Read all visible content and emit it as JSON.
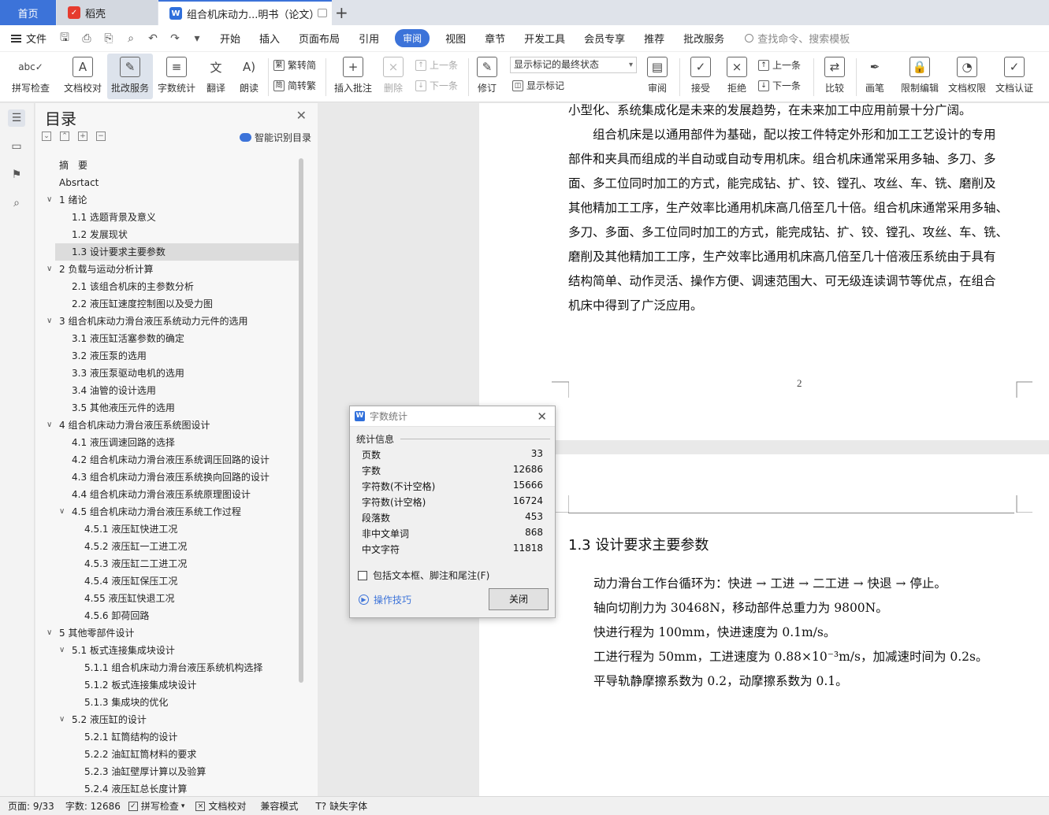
{
  "tabs": {
    "home": "首页",
    "daoke": "稻壳",
    "doc": "组合机床动力...明书（论文）"
  },
  "menubar": {
    "file": "文件",
    "items": [
      "开始",
      "插入",
      "页面布局",
      "引用",
      "审阅",
      "视图",
      "章节",
      "开发工具",
      "会员专享",
      "推荐",
      "批改服务"
    ],
    "active": "审阅",
    "search": "查找命令、搜索模板"
  },
  "ribbon": {
    "spell": "拼写检查",
    "doccheck": "文档校对",
    "revise_service": "批改服务",
    "wordcount": "字数统计",
    "translate": "翻译",
    "read": "朗读",
    "trad": "繁转简",
    "simp": "简转繁",
    "insert_comment": "插入批注",
    "delete": "删除",
    "prev": "上一条",
    "next": "下一条",
    "track": "修订",
    "markup_state": "显示标记的最终状态",
    "show_markup": "显示标记",
    "review": "审阅",
    "accept": "接受",
    "reject": "拒绝",
    "prev2": "上一条",
    "next2": "下一条",
    "compare": "比较",
    "pen": "画笔",
    "restrict": "限制编辑",
    "permission": "文档权限",
    "certify": "文档认证"
  },
  "toc": {
    "title": "目录",
    "smart": "智能识别目录",
    "items": [
      {
        "text": "摘　要",
        "level": 0
      },
      {
        "text": "Absrtact",
        "level": 0
      },
      {
        "text": "1  绪论",
        "level": 1
      },
      {
        "text": "1.1  选题背景及意义",
        "level": 2
      },
      {
        "text": "1.2  发展现状",
        "level": 2
      },
      {
        "text": "1.3  设计要求主要参数",
        "level": 2,
        "selected": true
      },
      {
        "text": "2  负载与运动分析计算",
        "level": 1
      },
      {
        "text": "2.1  该组合机床的主参数分析",
        "level": 2
      },
      {
        "text": "2.2  液压缸速度控制图以及受力图",
        "level": 2
      },
      {
        "text": "3  组合机床动力滑台液压系统动力元件的选用",
        "level": 1
      },
      {
        "text": "3.1  液压缸活塞参数的确定",
        "level": 2
      },
      {
        "text": "3.2  液压泵的选用",
        "level": 2
      },
      {
        "text": "3.3  液压泵驱动电机的选用",
        "level": 2
      },
      {
        "text": "3.4  油管的设计选用",
        "level": 2
      },
      {
        "text": "3.5  其他液压元件的选用",
        "level": 2
      },
      {
        "text": "4  组合机床动力滑台液压系统图设计",
        "level": 1
      },
      {
        "text": "4.1  液压调速回路的选择",
        "level": 2
      },
      {
        "text": "4.2  组合机床动力滑台液压系统调压回路的设计",
        "level": 2
      },
      {
        "text": "4.3  组合机床动力滑台液压系统换向回路的设计",
        "level": 2
      },
      {
        "text": "4.4  组合机床动力滑台液压系统原理图设计",
        "level": 2
      },
      {
        "text": "4.5  组合机床动力滑台液压系统工作过程",
        "level": 2,
        "expand": true
      },
      {
        "text": "4.5.1  液压缸快进工况",
        "level": 3
      },
      {
        "text": "4.5.2  液压缸一工进工况",
        "level": 3
      },
      {
        "text": "4.5.3 液压缸二工进工况",
        "level": 3
      },
      {
        "text": "4.5.4  液压缸保压工况",
        "level": 3
      },
      {
        "text": "4.55  液压缸快退工况",
        "level": 3
      },
      {
        "text": "4.5.6  卸荷回路",
        "level": 3
      },
      {
        "text": "5  其他零部件设计",
        "level": 1
      },
      {
        "text": "5.1  板式连接集成块设计",
        "level": 2,
        "expand": true
      },
      {
        "text": "5.1.1  组合机床动力滑台液压系统机构选择",
        "level": 3
      },
      {
        "text": "5.1.2  板式连接集成块设计",
        "level": 3
      },
      {
        "text": "5.1.3  集成块的优化",
        "level": 3
      },
      {
        "text": "5.2  液压缸的设计",
        "level": 2,
        "expand": true
      },
      {
        "text": "5.2.1  缸筒结构的设计",
        "level": 3
      },
      {
        "text": "5.2.2  油缸缸筒材料的要求",
        "level": 3
      },
      {
        "text": "5.2.3  油缸壁厚计算以及验算",
        "level": 3
      },
      {
        "text": "5.2.4  液压缸总长度计算",
        "level": 3
      }
    ]
  },
  "document": {
    "page1_lines": [
      "小型化、系统集成化是未来的发展趋势，在未来加工中应用前景十分广阔。",
      "　　组合机床是以通用部件为基础，配以按工件特定外形和加工工艺设计的专用",
      "部件和夹具而组成的半自动或自动专用机床。组合机床通常采用多轴、多刀、多",
      "面、多工位同时加工的方式，能完成钻、扩、铰、镗孔、攻丝、车、铣、磨削及",
      "其他精加工工序，生产效率比通用机床高几倍至几十倍。组合机床通常采用多轴、",
      "多刀、多面、多工位同时加工的方式，能完成钻、扩、铰、镗孔、攻丝、车、铣、",
      "磨削及其他精加工工序，生产效率比通用机床高几倍至几十倍液压系统由于具有",
      "结构简单、动作灵活、操作方便、调速范围大、可无级连读调节等优点，在组合",
      "机床中得到了广泛应用。"
    ],
    "page_number": "2",
    "heading": "1.3  设计要求主要参数",
    "page2_lines": [
      "动力滑台工作台循环为：快进 → 工进 → 二工进 → 快退 → 停止。",
      "轴向切削力为 30468N，移动部件总重力为 9800N。",
      "快进行程为 100mm，快进速度为 0.1m/s。",
      "工进行程为 50mm，工进速度为 0.88×10⁻³m/s，加减速时间为 0.2s。",
      "平导轨静摩擦系数为 0.2，动摩擦系数为 0.1。"
    ]
  },
  "dialog": {
    "title": "字数统计",
    "section": "统计信息",
    "stats": [
      {
        "label": "页数",
        "value": "33"
      },
      {
        "label": "字数",
        "value": "12686"
      },
      {
        "label": "字符数(不计空格)",
        "value": "15666"
      },
      {
        "label": "字符数(计空格)",
        "value": "16724"
      },
      {
        "label": "段落数",
        "value": "453"
      },
      {
        "label": "非中文单词",
        "value": "868"
      },
      {
        "label": "中文字符",
        "value": "11818"
      }
    ],
    "checkbox": "包括文本框、脚注和尾注(F)",
    "tips": "操作技巧",
    "close": "关闭"
  },
  "status": {
    "page": "页面: 9/33",
    "words": "字数: 12686",
    "spell": "拼写检查",
    "doccheck": "文档校对",
    "compat": "兼容模式",
    "missing_font": "缺失字体"
  }
}
